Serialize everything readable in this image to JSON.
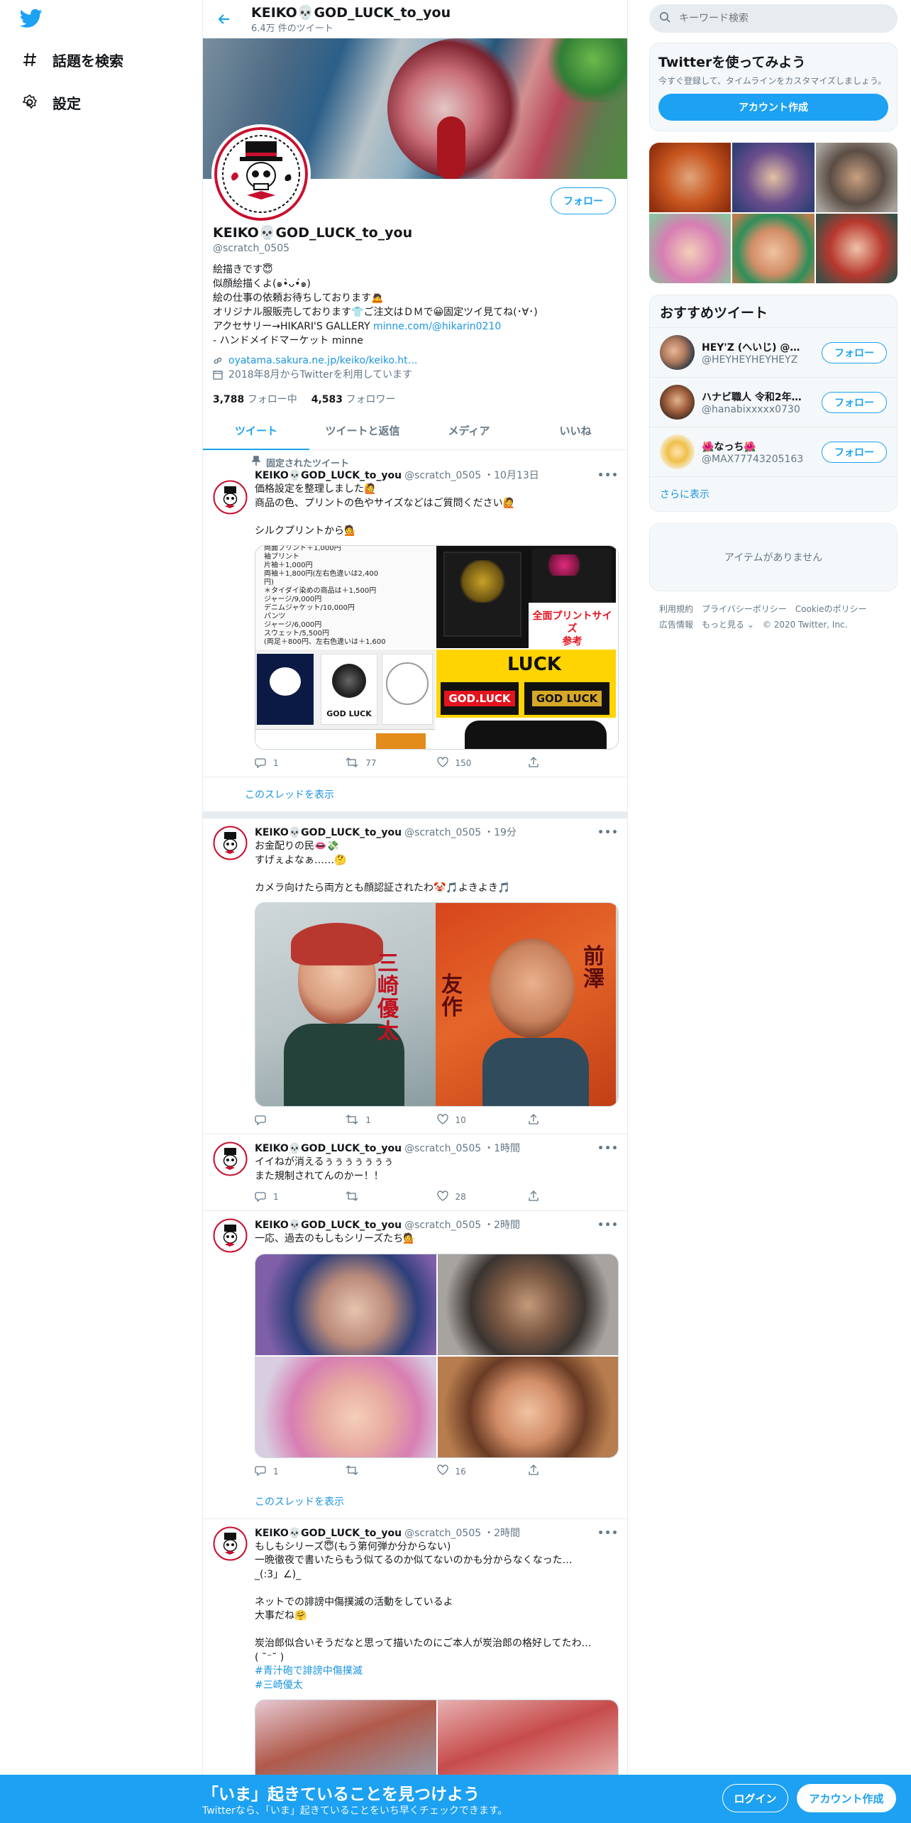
{
  "colors": {
    "accent": "#1da1f2",
    "border": "#e6ecf0",
    "muted": "#657786"
  },
  "nav": {
    "explore": "話題を検索",
    "settings": "設定"
  },
  "topbar": {
    "title": "KEIKO💀GOD_LUCK_to_you",
    "tweet_count": "6.4万 件のツイート"
  },
  "profile": {
    "name": "KEIKO💀GOD_LUCK_to_you",
    "handle": "@scratch_0505",
    "follow_label": "フォロー",
    "bio": [
      "絵描きです😇",
      "似顔絵描くよ(๑•̀ᴗ•́๑)",
      "絵の仕事の依頼お待ちしております🙇",
      "オリジナル服販売しております👕ご注文はＤＭで😀固定ツイ見てね(･∀･)",
      "アクセサリー→HIKARI'S GALLERY ",
      "- ハンドメイドマーケット minne"
    ],
    "bio_link": "minne.com/@hikarin0210",
    "website": "oyatama.sakura.ne.jp/keiko/keiko.ht…",
    "joined": "2018年8月からTwitterを利用しています",
    "following_count": "3,788",
    "following_label": "フォロー中",
    "followers_count": "4,583",
    "followers_label": "フォロワー"
  },
  "tabs": [
    "ツイート",
    "ツイートと返信",
    "メディア",
    "いいね"
  ],
  "tweets": [
    {
      "pinned": "固定されたツイート",
      "name": "KEIKO💀GOD_LUCK_to_you",
      "handle": "@scratch_0505",
      "time": "10月13日",
      "lines": [
        "価格設定を整理しました🙋",
        "商品の色、プリントの色やサイズなどはご質問ください🙋",
        "",
        "シルクプリントから💁"
      ],
      "reply": "1",
      "retweet": "77",
      "like": "150",
      "thread": "このスレッドを表示"
    },
    {
      "name": "KEIKO💀GOD_LUCK_to_you",
      "handle": "@scratch_0505",
      "time": "19分",
      "lines": [
        "お金配りの民👄💸",
        "すげぇよなぁ……🤔",
        "",
        "カメラ向けたら両方とも顔認証されたわ🤡🎵よきよき🎵"
      ],
      "reply": "",
      "retweet": "1",
      "like": "10"
    },
    {
      "name": "KEIKO💀GOD_LUCK_to_you",
      "handle": "@scratch_0505",
      "time": "1時間",
      "lines": [
        "イイねが消えるぅぅぅぅぅぅぅ",
        "また規制されてんのかー！！"
      ],
      "reply": "1",
      "retweet": "",
      "like": "28"
    },
    {
      "name": "KEIKO💀GOD_LUCK_to_you",
      "handle": "@scratch_0505",
      "time": "2時間",
      "lines": [
        "一応、過去のもしもシリーズたち💁"
      ],
      "reply": "1",
      "retweet": "",
      "like": "16",
      "thread": "このスレッドを表示"
    },
    {
      "name": "KEIKO💀GOD_LUCK_to_you",
      "handle": "@scratch_0505",
      "time": "2時間",
      "lines": [
        "もしもシリーズ😇(もう第何弾か分からない)",
        "一晩徹夜で書いたらもう似てるのか似てないのかも分からなくなった…",
        "_(:3」∠)_",
        "",
        "ネットでの誹謗中傷撲滅の活動をしているよ",
        "大事だね🤗",
        "",
        "炭治郎似合いそうだなと思って描いたのにご本人が炭治郎の格好してたわ…",
        "( ˘⁻˘ )"
      ],
      "tags": [
        "#青汁砲で誹謗中傷撲滅",
        "#三崎優太"
      ]
    }
  ],
  "price_list": [
    "両面プリント＋1,000円",
    "袖プリント",
    "片袖＋1,000円",
    "両袖＋1,800円(左右色違いは2,400",
    "円)",
    "＊タイダイ染めの商品は＋1,500円",
    "ジャージ/9,000円",
    "デニムジャケット/10,000円",
    "パンツ",
    "ジャージ/6,000円",
    "スウェット/5,500円",
    "(両足＋800円、左右色違いは＋1,600"
  ],
  "media_text": {
    "full_print_1": "全面プリントサイズ",
    "full_print_2": "参考",
    "godluck": "GOD LUCK",
    "god_luck_label": "GOD.LUCK",
    "god_luck_label2": "GOD LUCK",
    "luck": "LUCK",
    "portrait_text_1": "三崎優太",
    "portrait_text_2": "友作",
    "portrait_text_3": "前澤"
  },
  "sidebar": {
    "search_placeholder": "キーワード検索",
    "signup_title": "Twitterを使ってみよう",
    "signup_text": "今すぐ登録して、タイムラインをカスタマイズしましょう。",
    "signup_button": "アカウント作成",
    "recs_title": "おすすめツイート",
    "recs": [
      {
        "name": "HEY'Z (へいじ) @…",
        "handle": "@HEYHEYHEYHEYZ"
      },
      {
        "name": "ハナビ職人 令和2年…",
        "handle": "@hanabixxxxx0730"
      },
      {
        "name": "🌺なっち🌺",
        "handle": "@MAX77743205163"
      }
    ],
    "rec_follow": "フォロー",
    "show_more": "さらに表示",
    "no_items": "アイテムがありません",
    "footer": [
      "利用規約",
      "プライバシーポリシー",
      "Cookieのポリシー",
      "広告情報",
      "もっと見る ⌄",
      "© 2020 Twitter, Inc."
    ]
  },
  "bottom_bar": {
    "title": "「いま」起きていることを見つけよう",
    "subtitle": "Twitterなら、「いま」起きていることをいち早くチェックできます。",
    "login": "ログイン",
    "signup": "アカウント作成"
  }
}
